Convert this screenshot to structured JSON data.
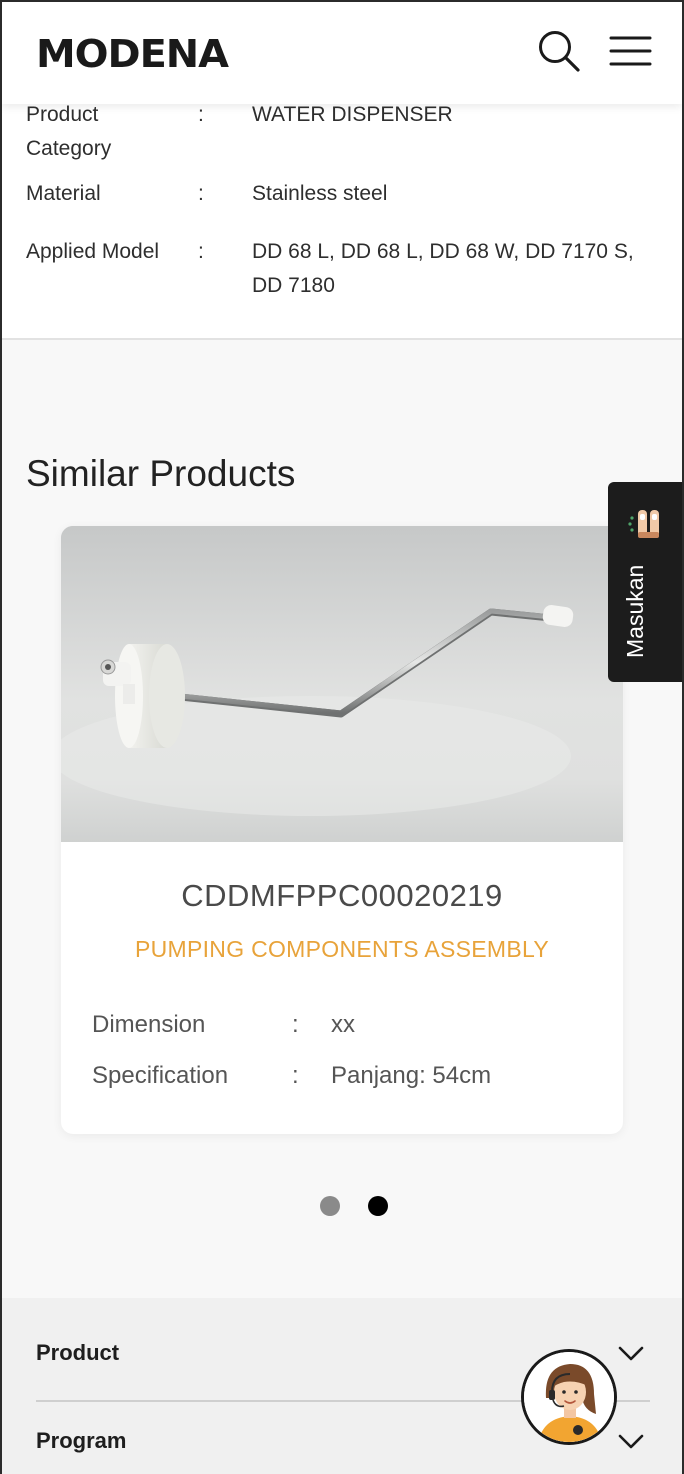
{
  "header": {
    "logo": "MODENA",
    "icons": [
      "search-icon",
      "hamburger-menu-icon"
    ]
  },
  "spec": {
    "rows": [
      {
        "label": "Product Category",
        "colon": ":",
        "value": "WATER DISPENSER"
      },
      {
        "label": "Material",
        "colon": ":",
        "value": "Stainless steel"
      },
      {
        "label": "Applied Model",
        "colon": ":",
        "value": "DD 68 L, DD 68 L, DD 68 W, DD 7170 S, DD 7180"
      }
    ]
  },
  "similar": {
    "title": "Similar Products",
    "card": {
      "code": "CDDMFPPC00020219",
      "name": "PUMPING COMPONENTS ASSEMBLY",
      "rows": [
        {
          "key": "Dimension",
          "colon": ":",
          "value": "xx"
        },
        {
          "key": "Specification",
          "colon": ":",
          "value": "Panjang: 54cm"
        }
      ]
    },
    "carousel": {
      "slide_count": 2,
      "active_index": 1
    }
  },
  "feedback_tab": {
    "label": "Masukan",
    "icon": "feedback-hands-icon"
  },
  "footer": {
    "items": [
      {
        "label": "Product",
        "icon": "chevron-down-icon"
      },
      {
        "label": "Program",
        "icon": "chevron-down-icon"
      }
    ]
  },
  "chat": {
    "icon": "customer-service-avatar-icon"
  },
  "colors": {
    "accent": "#e8a33a",
    "dark": "#1c1c1c",
    "dot_inactive": "#8a8a8a",
    "dot_active": "#000000"
  }
}
